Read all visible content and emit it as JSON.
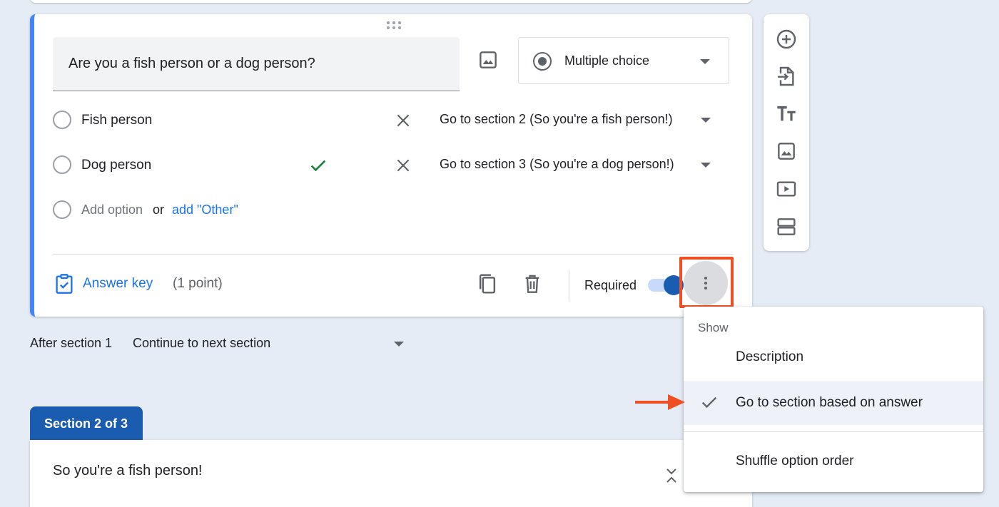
{
  "question": {
    "title": "Are you a fish person or a dog person?",
    "type_label": "Multiple choice",
    "options": [
      {
        "label": "Fish person",
        "goto": "Go to section 2 (So you're a fish person!)"
      },
      {
        "label": "Dog person",
        "goto": "Go to section 3 (So you're a dog person!)"
      }
    ],
    "add_option": "Add option",
    "or_text": "or",
    "add_other": "add \"Other\"",
    "answer_key": "Answer key",
    "points": "(1 point)",
    "required_label": "Required"
  },
  "after_section": {
    "label": "After section 1",
    "value": "Continue to next section"
  },
  "menu": {
    "header": "Show",
    "items": [
      "Description",
      "Go to section based on answer",
      "Shuffle option order"
    ]
  },
  "section": {
    "tab": "Section 2 of 3",
    "title": "So you're a fish person!"
  },
  "colors": {
    "accent": "#1a73e8",
    "brand": "#1a5cb0",
    "highlight": "#f04e23",
    "check": "#188038"
  },
  "icons": {
    "tools": [
      "add-question-icon",
      "import-questions-icon",
      "add-title-icon",
      "add-image-icon",
      "add-video-icon",
      "add-section-icon"
    ]
  }
}
